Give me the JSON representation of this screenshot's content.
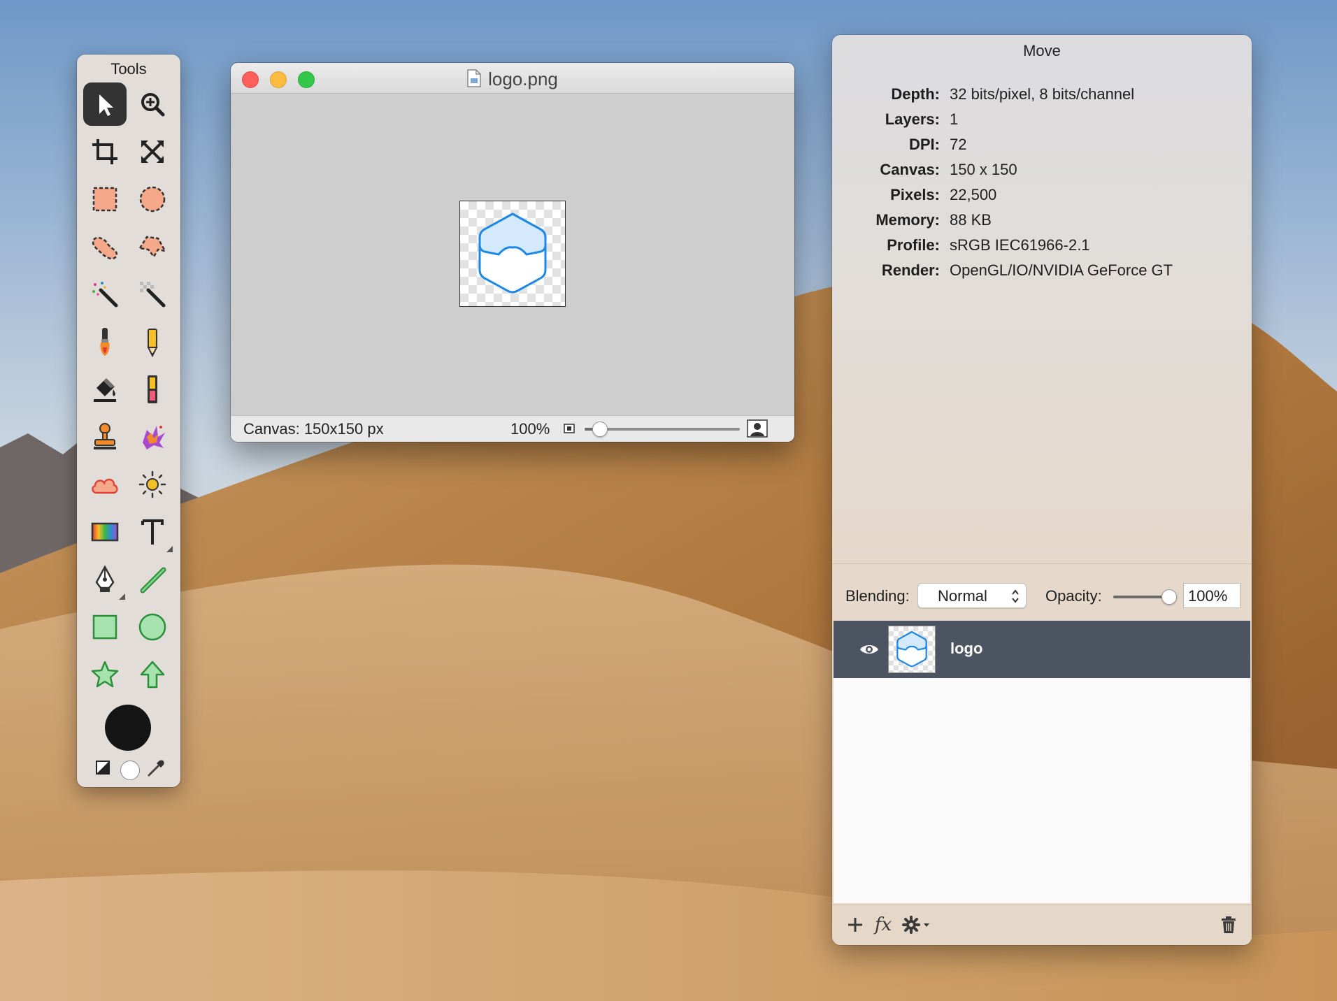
{
  "colors": {
    "accent_active_tool": "#333333",
    "layer_selected": "#4d5461",
    "close": "#fc605b",
    "minimize": "#fdbc40",
    "zoom": "#34c84a",
    "primary_color": "#151515",
    "secondary_color": "#ffffff"
  },
  "tools": {
    "title": "Tools",
    "items": [
      {
        "name": "move-tool",
        "icon": "arrow-pointer-icon",
        "active": true
      },
      {
        "name": "zoom-tool",
        "icon": "magnifier-plus-icon"
      },
      {
        "name": "crop-tool",
        "icon": "crop-icon"
      },
      {
        "name": "resize-tool",
        "icon": "expand-arrows-icon"
      },
      {
        "name": "rect-select-tool",
        "icon": "rect-selection-icon"
      },
      {
        "name": "ellipse-select-tool",
        "icon": "ellipse-selection-icon"
      },
      {
        "name": "lasso-tool",
        "icon": "lasso-icon"
      },
      {
        "name": "polygon-lasso-tool",
        "icon": "polygon-lasso-icon"
      },
      {
        "name": "magic-wand-tool",
        "icon": "magic-wand-icon"
      },
      {
        "name": "remove-background-tool",
        "icon": "checker-wand-icon"
      },
      {
        "name": "brush-tool",
        "icon": "brush-icon"
      },
      {
        "name": "pencil-tool",
        "icon": "pencil-icon"
      },
      {
        "name": "fill-tool",
        "icon": "paint-bucket-icon"
      },
      {
        "name": "eraser-tool",
        "icon": "eraser-icon"
      },
      {
        "name": "clone-stamp-tool",
        "icon": "stamp-icon"
      },
      {
        "name": "retouch-tool",
        "icon": "splat-icon"
      },
      {
        "name": "cloud-tool",
        "icon": "cloud-icon"
      },
      {
        "name": "sun-tool",
        "icon": "sun-icon"
      },
      {
        "name": "gradient-tool",
        "icon": "gradient-icon"
      },
      {
        "name": "text-tool",
        "icon": "text-t-icon"
      },
      {
        "name": "pen-tool",
        "icon": "pen-nib-icon"
      },
      {
        "name": "line-tool",
        "icon": "line-icon"
      },
      {
        "name": "rectangle-shape-tool",
        "icon": "rectangle-icon"
      },
      {
        "name": "ellipse-shape-tool",
        "icon": "circle-icon"
      },
      {
        "name": "star-shape-tool",
        "icon": "star-icon"
      },
      {
        "name": "arrow-shape-tool",
        "icon": "arrow-up-icon"
      }
    ]
  },
  "document": {
    "title": "logo.png",
    "status": {
      "canvas_size": "Canvas: 150x150 px",
      "zoom_label": "100%",
      "zoom_level": 0.1
    }
  },
  "panel": {
    "title": "Move",
    "info": [
      {
        "label": "Depth:",
        "value": "32 bits/pixel, 8 bits/channel"
      },
      {
        "label": "Layers:",
        "value": "1"
      },
      {
        "label": "DPI:",
        "value": "72"
      },
      {
        "label": "Canvas:",
        "value": "150 x 150"
      },
      {
        "label": "Pixels:",
        "value": "22,500"
      },
      {
        "label": "Memory:",
        "value": "88 KB"
      },
      {
        "label": "Profile:",
        "value": "sRGB IEC61966-2.1"
      },
      {
        "label": "Render:",
        "value": "OpenGL/IO/NVIDIA GeForce GT"
      }
    ],
    "blending": {
      "label": "Blending:",
      "value": "Normal",
      "opacity_label": "Opacity:",
      "opacity_value": "100%",
      "opacity_level": 1.0
    },
    "layers": [
      {
        "name": "logo",
        "visible": true,
        "selected": true
      }
    ],
    "footer": {
      "add_icon": "plus-icon",
      "fx_label": "fx",
      "gear_icon": "gear-icon",
      "trash_icon": "trash-icon"
    }
  }
}
